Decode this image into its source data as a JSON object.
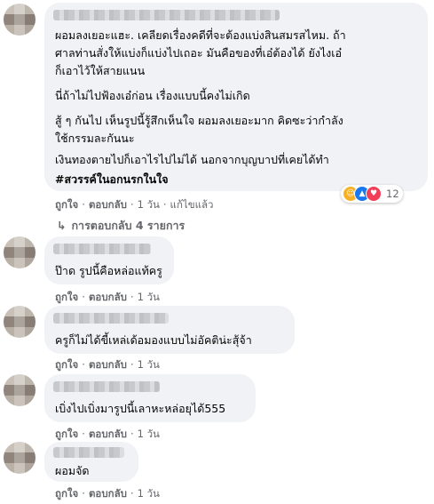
{
  "comments": [
    {
      "lines": [
        "ผอมลงเยอะแฮะ. เคลียดเรื่องคดีที่จะต้องแบ่งสินสมรสไหม. ถ้า",
        "ศาลท่านสั่งให้แบ่งก็แบ่งไปเถอะ มันคือของที่เอ๋ต้องได้ ยังไงเอ๋",
        "ก็เอาไว้ให้สายแนน",
        "นี่ถ้าไม่ไปฟ้องเอ๋ก่อน เรื่องแบบนี้คงไม่เกิด",
        "สู้ ๆ กันไป เห็นรูปนี้รู้สึกเห็นใจ ผอมลงเยอะมาก คิดซะว่ากำลัง",
        "ใช้กรรมละกันนะ",
        "เงินทองตายไปก็เอาไรไปไม่ได้ นอกจากบุญบาปที่เคยได้ทำ"
      ],
      "hashtag": "#สวรรค์ในอกนรกในใจ",
      "like": "ถูกใจ",
      "reply": "ตอบกลับ",
      "time": "1 วัน",
      "edited": "แก้ไขแล้ว",
      "reaction_count": "12",
      "replies_link": "การตอบกลับ 4 รายการ"
    },
    {
      "text": "ป๊าด รูปนี้คือหล่อแท้ครู",
      "like": "ถูกใจ",
      "reply": "ตอบกลับ",
      "time": "1 วัน"
    },
    {
      "text": "ครูก็ไม่ได้ขี้เหล่เด้อมองแบบไม่อัคติน่ะสุ้จ้า",
      "like": "ถูกใจ",
      "reply": "ตอบกลับ",
      "time": "1 วัน"
    },
    {
      "text": "เบิ่งไปเบิ่งมารูปนี้เลาหะหล่อยุได้555",
      "like": "ถูกใจ",
      "reply": "ตอบกลับ",
      "time": "1 วัน"
    },
    {
      "text": "ผอมจัด",
      "like": "ถูกใจ",
      "reply": "ตอบกลับ",
      "time": "1 วัน"
    }
  ],
  "separator": "·",
  "icons": {
    "reaction_haha": "haha-icon",
    "reaction_like": "like-icon",
    "reaction_love": "love-icon",
    "replies_arrow": "reply-arrow-icon"
  },
  "colors": {
    "bubble": "#f0f2f5",
    "meta": "#65676b",
    "text": "#050505",
    "like": "#1877f2",
    "love": "#f33e58",
    "haha": "#f7b125"
  }
}
